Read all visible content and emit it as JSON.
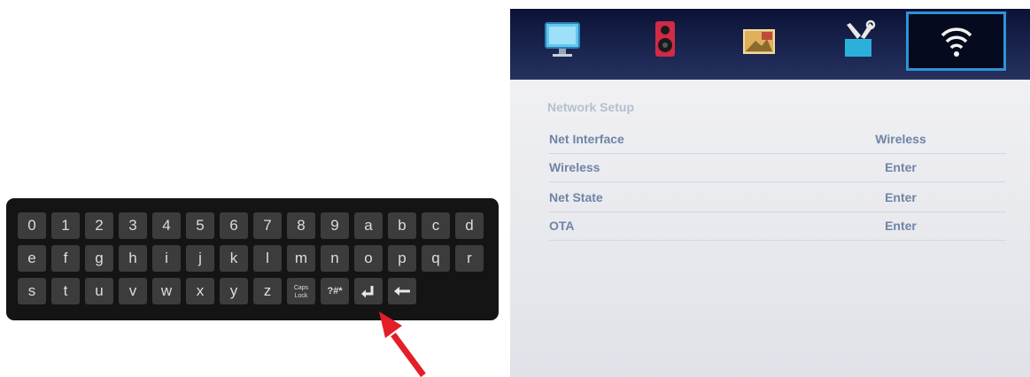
{
  "keyboard": {
    "rows": [
      [
        "0",
        "1",
        "2",
        "3",
        "4",
        "5",
        "6",
        "7",
        "8",
        "9",
        "a",
        "b",
        "c",
        "d"
      ],
      [
        "e",
        "f",
        "g",
        "h",
        "i",
        "j",
        "k",
        "l",
        "m",
        "n",
        "o",
        "p",
        "q",
        "r"
      ],
      [
        "s",
        "t",
        "u",
        "v",
        "w",
        "x",
        "y",
        "z"
      ]
    ],
    "caps_lock_label": "Caps Lock",
    "symbols_label": "?#*",
    "enter_icon": "enter-return-icon",
    "backspace_icon": "backspace-arrow-icon",
    "pointer_color": "#e41e26"
  },
  "tv_menu": {
    "tabs": [
      {
        "name": "picture",
        "icon": "monitor-icon"
      },
      {
        "name": "sound",
        "icon": "speaker-icon"
      },
      {
        "name": "media",
        "icon": "photo-icon"
      },
      {
        "name": "setup",
        "icon": "tools-icon"
      },
      {
        "name": "network",
        "icon": "wifi-icon",
        "selected": true
      }
    ],
    "section_title": "Network Setup",
    "rows": [
      {
        "label": "Net Interface",
        "value": "Wireless"
      },
      {
        "label": "Wireless",
        "value": "Enter"
      },
      {
        "label": "Net State",
        "value": "Enter"
      },
      {
        "label": "OTA",
        "value": "Enter"
      }
    ],
    "accent_color": "#2f93d8",
    "text_color": "#6f84a6"
  }
}
